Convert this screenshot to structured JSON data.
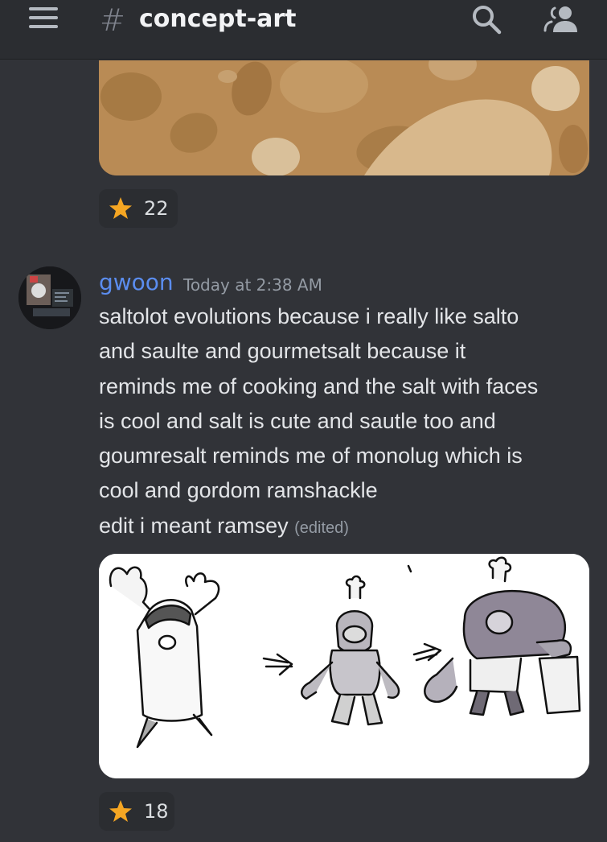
{
  "header": {
    "channel_hash": "#",
    "channel_name": "concept-art"
  },
  "reactions": {
    "first": {
      "emoji": "star-icon",
      "count": "22"
    },
    "second": {
      "emoji": "star-icon",
      "count": "18"
    }
  },
  "message": {
    "username": "gwoon",
    "timestamp": "Today at 2:38 AM",
    "lines": [
      "saltolot evolutions because i really like salto",
      "and saulte and gourmetsalt because it",
      "reminds me of cooking and the salt with faces",
      "is cool and salt is cute and sautle too and",
      "goumresalt reminds me of monolug which is",
      "cool and gordom ramshackle",
      "edit i meant ramsey"
    ],
    "edited_label": "(edited)"
  },
  "colors": {
    "background": "#313338",
    "header_bg": "#2b2d31",
    "username": "#5b8def",
    "star": "#f5a623"
  }
}
